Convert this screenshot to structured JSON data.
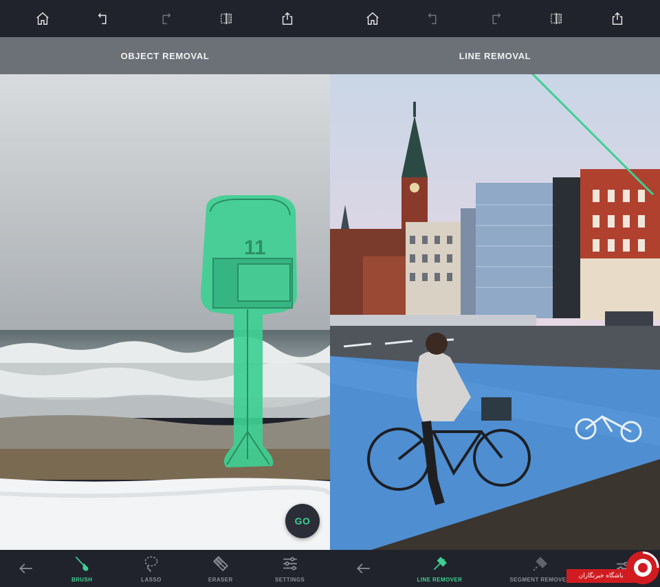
{
  "colors": {
    "toolbar_bg": "#20232b",
    "mode_bar_bg": "#6c7077",
    "accent_green": "#3ecf93",
    "inactive_gray": "#8b8f97",
    "bike_lane_blue": "#4f8ed1",
    "watermark_red": "#d01c21"
  },
  "left_panel": {
    "top_toolbar": {
      "icons": [
        "home-icon",
        "undo-icon",
        "redo-icon",
        "compare-icon",
        "share-icon"
      ]
    },
    "mode_title": "OBJECT REMOVAL",
    "photo": {
      "scene": "beach-with-mailbox",
      "mask_color": "#3ecf93"
    },
    "go_button": "GO",
    "bottom_toolbar": {
      "back_icon": "arrow-left-icon",
      "tools": [
        {
          "label": "BRUSH",
          "icon": "brush-icon",
          "active": true
        },
        {
          "label": "LASSO",
          "icon": "lasso-icon",
          "active": false
        },
        {
          "label": "ERASER",
          "icon": "eraser-icon",
          "active": false
        },
        {
          "label": "SETTINGS",
          "icon": "sliders-icon",
          "active": false
        }
      ]
    }
  },
  "right_panel": {
    "top_toolbar": {
      "icons": [
        "home-icon",
        "undo-icon",
        "redo-icon",
        "compare-icon",
        "share-icon"
      ]
    },
    "mode_title": "LINE REMOVAL",
    "photo": {
      "scene": "city-street-cyclist",
      "line_color": "#3ecf93"
    },
    "bottom_toolbar": {
      "back_icon": "arrow-left-icon",
      "tools": [
        {
          "label": "LINE REMOVER",
          "icon": "line-remover-icon",
          "active": true
        },
        {
          "label": "SEGMENT REMOVER",
          "icon": "segment-remover-icon",
          "active": false
        },
        {
          "label": "",
          "icon": "sliders-icon",
          "active": false
        }
      ]
    }
  },
  "watermark": {
    "text": "باشگاه خبرنگاران",
    "logo": "watermark-logo"
  }
}
